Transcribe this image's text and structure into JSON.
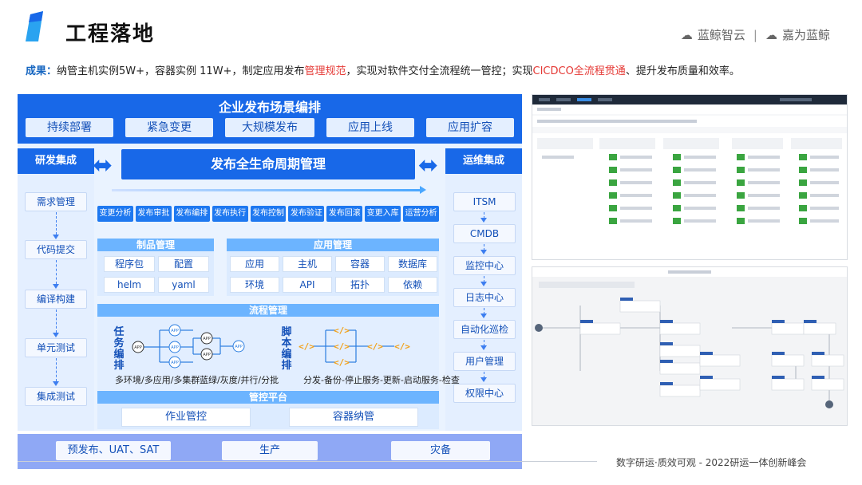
{
  "header": {
    "title": "工程落地",
    "brand_left": "蓝鲸智云",
    "brand_sep": "|",
    "brand_right": "嘉为蓝鲸"
  },
  "result": {
    "lead": "成果：",
    "text1": "纳管主机实例5W+，容器实例  11W+，制定应用发布",
    "highlight1": "管理规范",
    "text2": "，实现对软件交付全流程统一管控；实现",
    "highlight2": "CICDCO全流程贯通",
    "text3": "、提升发布质量和效率。"
  },
  "diagram": {
    "top_title": "企业发布场景编排",
    "scenes": [
      "持续部署",
      "紧急变更",
      "大规模发布",
      "应用上线",
      "应用扩容"
    ],
    "left_head": "研发集成",
    "left_items": [
      "需求管理",
      "代码提交",
      "编译构建",
      "单元测试",
      "集成测试"
    ],
    "right_head": "运维集成",
    "right_items": [
      "ITSM",
      "CMDB",
      "监控中心",
      "日志中心",
      "自动化巡检",
      "用户管理",
      "权限中心"
    ],
    "center_title": "发布全生命周期管理",
    "steps": [
      "变更分析",
      "发布审批",
      "发布编排",
      "发布执行",
      "发布控制",
      "发布验证",
      "发布回滚",
      "变更入库",
      "运营分析"
    ],
    "product_panel": {
      "title": "制品管理",
      "items": [
        "程序包",
        "配置",
        "helm",
        "yaml"
      ]
    },
    "app_panel": {
      "title": "应用管理",
      "items": [
        "应用",
        "主机",
        "容器",
        "数据库",
        "环境",
        "API",
        "拓扑",
        "依赖"
      ]
    },
    "flow_panel": {
      "title": "流程管理",
      "task_label": "任务编排",
      "task_caption": "多环境/多应用/多集群",
      "task_caption2": "蓝绿/灰度/并行/分批",
      "script_label": "脚本编排",
      "script_caption": "分发-备份-停止服务-更新-启动服务-检查",
      "node_label": "APP"
    },
    "control_panel": {
      "title": "管控平台",
      "items": [
        "作业管控",
        "容器纳管"
      ]
    },
    "bottom_items": [
      "预发布、UAT、SAT",
      "生产",
      "灾备"
    ]
  },
  "footer": {
    "text": "数字研运·质效可观  -  2022研运一体创新峰会"
  },
  "colors": {
    "primary": "#1868e8",
    "accent_red": "#e53935",
    "panel_head": "#6cb4ff",
    "light_bg": "#eaf3ff"
  }
}
